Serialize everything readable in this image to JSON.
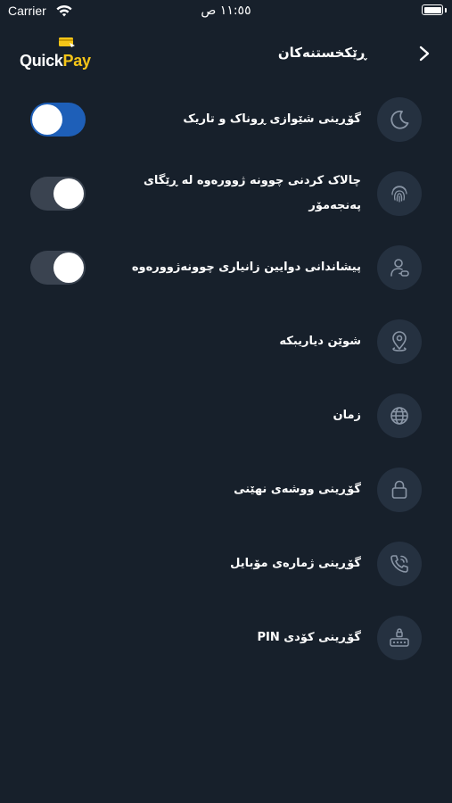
{
  "status_bar": {
    "carrier": "Carrier",
    "time": "١١:٥٥ ص",
    "wifi_icon": "wifi-icon",
    "battery_icon": "battery-icon"
  },
  "header": {
    "logo_part1": "Quick",
    "logo_part2": "Pay",
    "title": "ڕێکخستنەکان",
    "back_icon": "chevron-right-icon"
  },
  "settings": [
    {
      "icon": "moon-icon",
      "label": "گۆڕینی شێوازی ڕوناک و تاریک",
      "toggle": true,
      "toggle_on": true
    },
    {
      "icon": "fingerprint-icon",
      "label": "چالاک کردنی چوونە ژوورەوە لە ڕێگای پەنجەمۆر",
      "toggle": true,
      "toggle_on": false
    },
    {
      "icon": "user-login-icon",
      "label": "پیشاندانی دوایین زانیاری چوونەژوورەوە",
      "toggle": true,
      "toggle_on": false
    },
    {
      "icon": "location-pin-icon",
      "label": "شوێن دیاریبکە",
      "toggle": false
    },
    {
      "icon": "globe-icon",
      "label": "زمان",
      "toggle": false
    },
    {
      "icon": "lock-icon",
      "label": "گۆڕینی ووشەی نهێنی",
      "toggle": false
    },
    {
      "icon": "phone-call-icon",
      "label": "گۆڕینی ژمارەی مۆبایل",
      "toggle": false
    },
    {
      "icon": "pin-keypad-icon",
      "label": "گۆڕینی کۆدی PIN",
      "toggle": false
    }
  ],
  "colors": {
    "background": "#17202b",
    "icon_circle": "#253140",
    "toggle_on": "#1e5fb8",
    "toggle_off": "#3a4350",
    "brand_accent": "#f5c518"
  }
}
